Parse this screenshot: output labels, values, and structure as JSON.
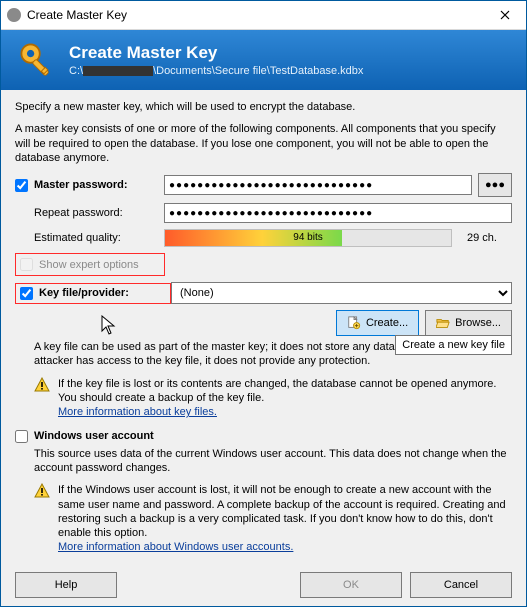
{
  "titlebar": {
    "title": "Create Master Key"
  },
  "header": {
    "title": "Create Master Key",
    "path_prefix": "C:\\",
    "path_suffix": "\\Documents\\Secure file\\TestDatabase.kdbx"
  },
  "intro": {
    "line1": "Specify a new master key, which will be used to encrypt the database.",
    "line2": "A master key consists of one or more of the following components. All components that you specify will be required to open the database. If you lose one component, you will not be able to open the database anymore."
  },
  "master_password": {
    "label": "Master password:",
    "value": "●●●●●●●●●●●●●●●●●●●●●●●●●●●●●",
    "reveal": "●●●"
  },
  "repeat_password": {
    "label": "Repeat password:",
    "value": "●●●●●●●●●●●●●●●●●●●●●●●●●●●●●"
  },
  "quality": {
    "label": "Estimated quality:",
    "bits": "94 bits",
    "fill_percent": 62,
    "chars": "29 ch."
  },
  "expert": {
    "label": "Show expert options"
  },
  "keyfile": {
    "label": "Key file/provider:",
    "selected": "(None)",
    "create": "Create...",
    "browse": "Browse...",
    "tooltip": "Create a new key file",
    "desc": "A key file can be used as part of the master key; it does not store any database data. If an attacker has access to the key file, it does not provide any protection.",
    "warn": "If the key file is lost or its contents are changed, the database cannot be opened anymore. You should create a backup of the key file.",
    "link": "More information about key files."
  },
  "wua": {
    "label": "Windows user account",
    "desc": "This source uses data of the current Windows user account. This data does not change when the account password changes.",
    "warn": "If the Windows user account is lost, it will not be enough to create a new account with the same user name and password. A complete backup of the account is required. Creating and restoring such a backup is a very complicated task. If you don't know how to do this, don't enable this option.",
    "link": "More information about Windows user accounts."
  },
  "footer": {
    "help": "Help",
    "ok": "OK",
    "cancel": "Cancel"
  }
}
